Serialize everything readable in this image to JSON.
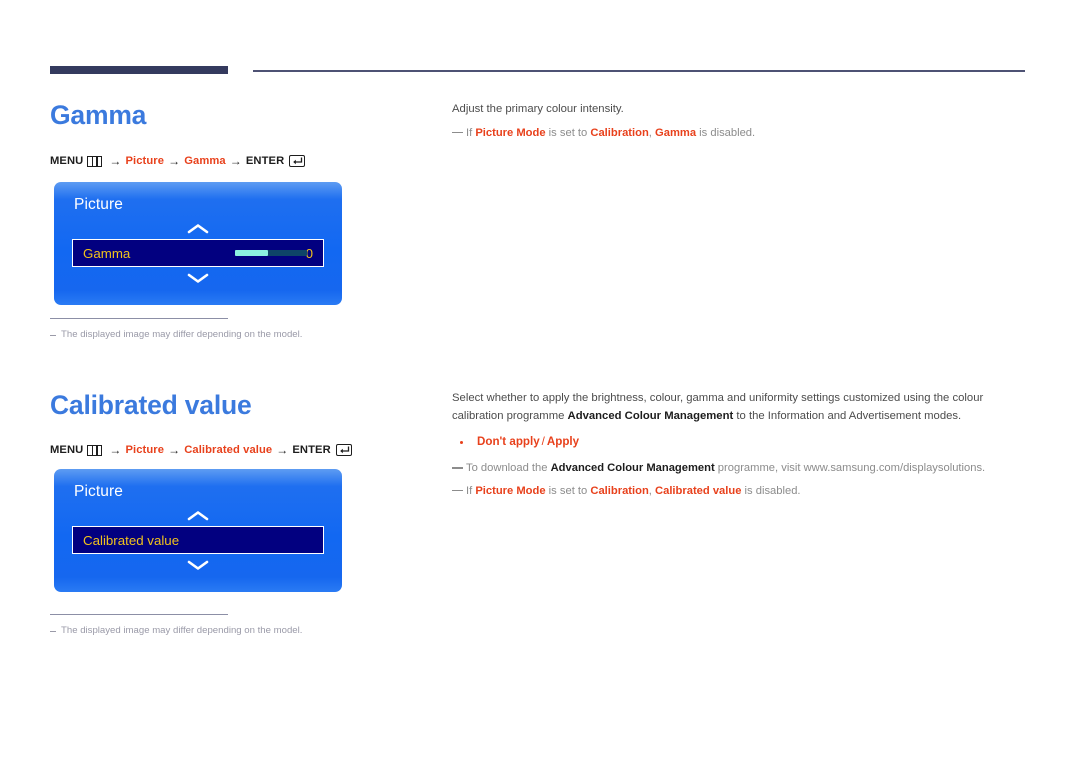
{
  "document": {
    "type": "user-manual-page",
    "accent_blue": "#3b7ade",
    "accent_red": "#e8411c",
    "rule_navy": "#343a5e"
  },
  "sections": [
    {
      "title": "Gamma",
      "breadcrumb": {
        "menu_label": "MENU",
        "menu_icon": "menu-icon",
        "arrow": "→",
        "step1": "Picture",
        "step2": "Gamma",
        "enter_label": "ENTER",
        "enter_icon": "enter-return-icon"
      },
      "osd": {
        "title": "Picture",
        "up_icon": "chevron-up-icon",
        "down_icon": "chevron-down-icon",
        "row_label": "Gamma",
        "row_value": "0",
        "has_slider": true
      },
      "footnote": "The displayed image may differ depending on the model.",
      "right": {
        "intro": "Adjust the primary colour intensity.",
        "notes": [
          {
            "parts": [
              {
                "t": "If ",
                "s": "plain"
              },
              {
                "t": "Picture Mode",
                "s": "red"
              },
              {
                "t": " is set to ",
                "s": "plain"
              },
              {
                "t": "Calibration",
                "s": "red"
              },
              {
                "t": ", ",
                "s": "plain"
              },
              {
                "t": "Gamma",
                "s": "red"
              },
              {
                "t": " is disabled.",
                "s": "plain"
              }
            ]
          }
        ]
      }
    },
    {
      "title": "Calibrated value",
      "breadcrumb": {
        "menu_label": "MENU",
        "menu_icon": "menu-icon",
        "arrow": "→",
        "step1": "Picture",
        "step2": "Calibrated value",
        "enter_label": "ENTER",
        "enter_icon": "enter-return-icon"
      },
      "osd": {
        "title": "Picture",
        "up_icon": "chevron-up-icon",
        "down_icon": "chevron-down-icon",
        "row_label": "Calibrated value",
        "row_value": "",
        "has_slider": false
      },
      "footnote": "The displayed image may differ depending on the model.",
      "right": {
        "intro_parts": [
          {
            "t": "Select whether to apply the brightness, colour, gamma and uniformity settings customized using the colour calibration programme ",
            "s": "plain"
          },
          {
            "t": "Advanced Colour Management",
            "s": "bold"
          },
          {
            "t": " to the Information and Advertisement modes.",
            "s": "plain"
          }
        ],
        "options": {
          "first": "Don't apply",
          "separator": "/",
          "second": "Apply"
        },
        "notes": [
          {
            "parts": [
              {
                "t": "To download the ",
                "s": "plain"
              },
              {
                "t": "Advanced Colour Management",
                "s": "bold"
              },
              {
                "t": " programme, visit www.samsung.com/displaysolutions.",
                "s": "plain"
              }
            ]
          },
          {
            "parts": [
              {
                "t": "If ",
                "s": "plain"
              },
              {
                "t": "Picture Mode",
                "s": "red"
              },
              {
                "t": " is set to ",
                "s": "plain"
              },
              {
                "t": "Calibration",
                "s": "red"
              },
              {
                "t": ", ",
                "s": "plain"
              },
              {
                "t": "Calibrated value",
                "s": "red"
              },
              {
                "t": " is disabled.",
                "s": "plain"
              }
            ]
          }
        ]
      }
    }
  ]
}
